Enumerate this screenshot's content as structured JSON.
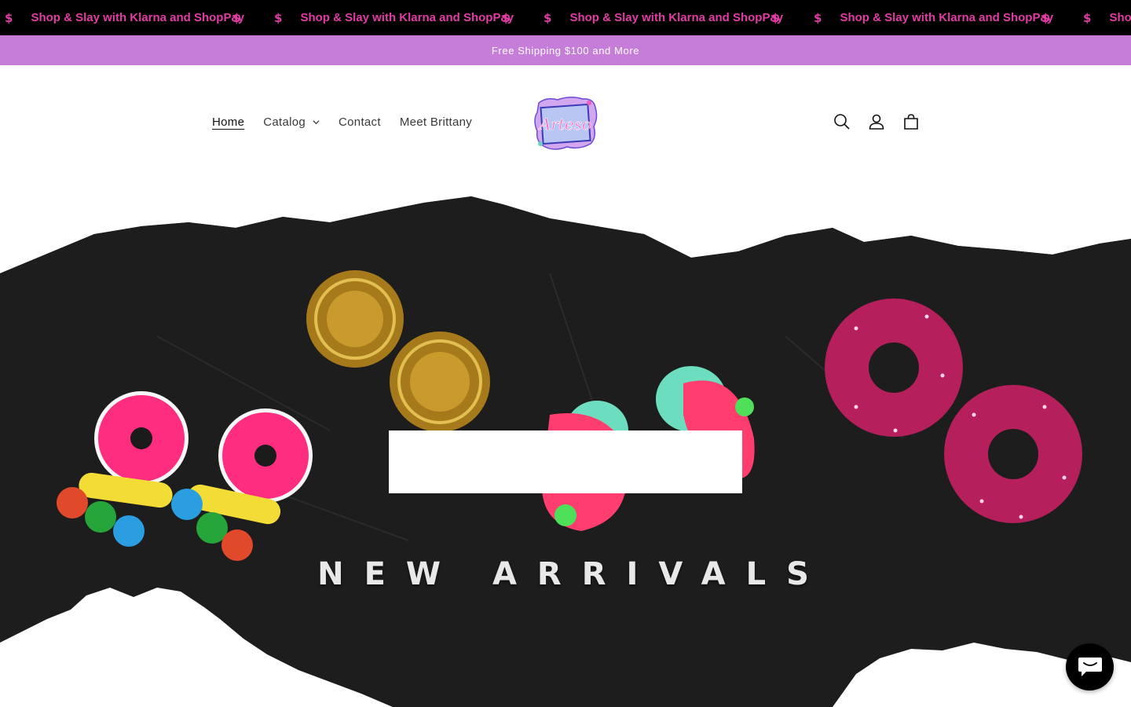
{
  "marquee": {
    "text": "Shop & Slay with Klarna and ShopPay",
    "symbol": "$",
    "color": "#e23ca5",
    "repeats": 5
  },
  "announcement": {
    "text": "Free Shipping $100 and More",
    "background": "#c57dd9"
  },
  "nav": {
    "home": "Home",
    "catalog": "Catalog",
    "contact": "Contact",
    "meet": "Meet Brittany"
  },
  "logo": {
    "alt_text": "Artesso"
  },
  "header_icons": [
    "search-icon",
    "account-icon",
    "cart-icon"
  ],
  "hero": {
    "title": "NEW ARRIVALS",
    "background": "#1c1c1c"
  },
  "chat": {
    "icon": "chat-icon"
  }
}
